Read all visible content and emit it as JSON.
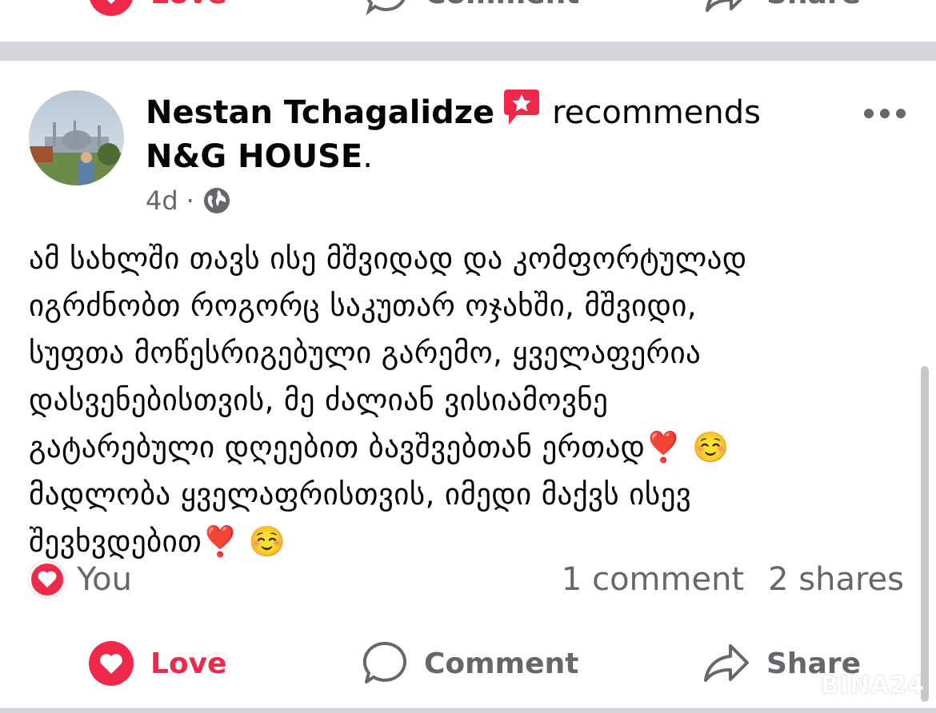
{
  "previous_post": {
    "love_label": "Love",
    "comment_label": "Comment",
    "share_label": "Share"
  },
  "post": {
    "author": "Nestan Tchagalidze",
    "action_text": "recommends",
    "page_name": "N&G HOUSE",
    "page_name_suffix": ".",
    "time": "4d",
    "separator": "·",
    "privacy_icon": "globe-icon",
    "text": "ამ სახლში თავს ისე მშვიდად და კომფორტულად\nიგრძნობთ როგორც საკუთარ ოჯახში, მშვიდი,\nსუფთა მოწესრიგებული გარემო, ყველაფერია\nდასვენებისთვის, მე ძალიან ვისიამოვნე\nგატარებული დღეებით ბავშვებთან ერთად❣️ ☺️\nმადლობა ყველაფრისთვის, იმედი მაქვს ისევ\nშევხვდებით❣️ ☺️"
  },
  "engagement": {
    "reaction_icon": "heart-reaction-icon",
    "reacted_by": "You",
    "comments": "1 comment",
    "shares": "2 shares"
  },
  "actions": {
    "love_label": "Love",
    "comment_label": "Comment",
    "share_label": "Share"
  },
  "watermark": "BINA24",
  "colors": {
    "love_red": "#f0284a",
    "secondary_text": "#65676b",
    "divider": "#d4d6da",
    "badge_red": "#f0284a"
  }
}
